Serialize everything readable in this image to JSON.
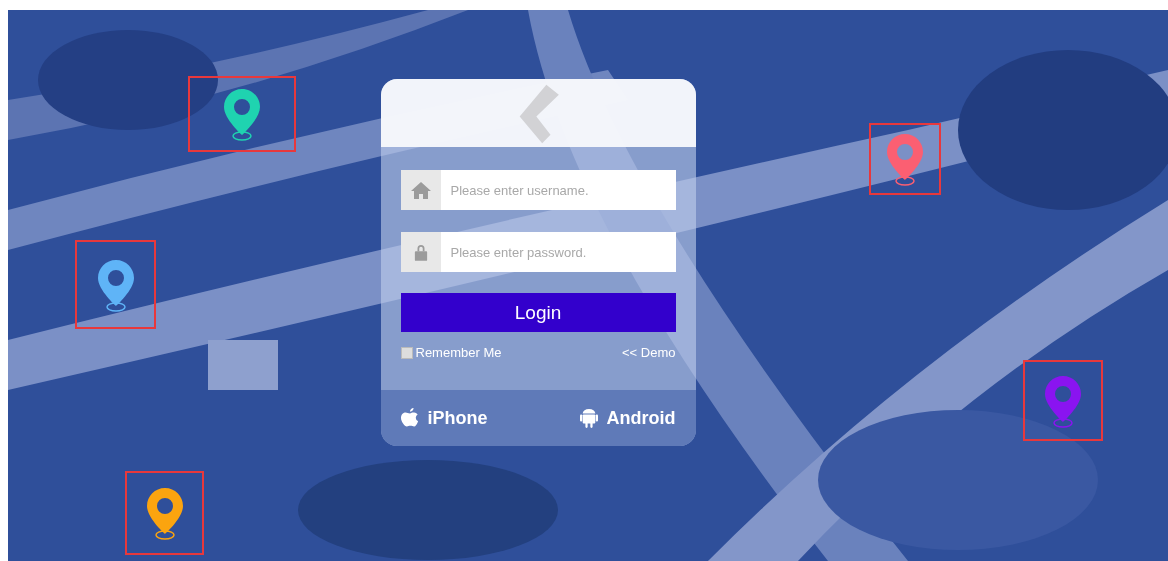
{
  "markers": [
    {
      "color": "#1fd3b0"
    },
    {
      "color": "#fb5f72"
    },
    {
      "color": "#5fb4f7"
    },
    {
      "color": "#8a14f0"
    },
    {
      "color": "#fba40f"
    }
  ],
  "login": {
    "username": {
      "placeholder": "Please enter username."
    },
    "password": {
      "placeholder": "Please enter password."
    },
    "submit": "Login",
    "remember": {
      "label": "Remember Me",
      "checked": false
    },
    "demo_link": "<< Demo",
    "apps": [
      "iPhone",
      "Android"
    ]
  }
}
